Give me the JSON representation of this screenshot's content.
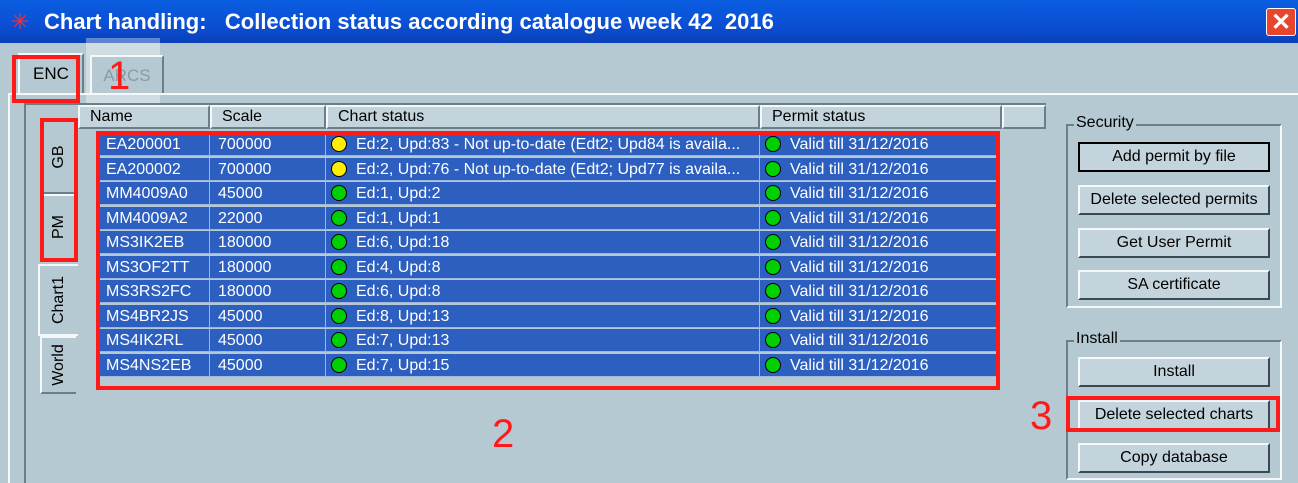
{
  "window": {
    "title": "Chart handling:   Collection status according catalogue week 42  2016",
    "close_glyph": "✕",
    "app_icon": "asterisk-icon"
  },
  "tabs": [
    "ENC",
    "ARCS"
  ],
  "side_tabs": [
    "GB",
    "PM",
    "Chart1",
    "World"
  ],
  "table": {
    "columns": [
      "Name",
      "Scale",
      "Chart status",
      "Permit status"
    ],
    "rows": [
      {
        "name": "EA200001",
        "scale": "700000",
        "status_color": "#ffee00",
        "chart_status": "Ed:2, Upd:83 - Not up-to-date (Edt2; Upd84 is availa...",
        "permit_color": "#00d000",
        "permit_status": "Valid till 31/12/2016"
      },
      {
        "name": "EA200002",
        "scale": "700000",
        "status_color": "#ffee00",
        "chart_status": "Ed:2, Upd:76 - Not up-to-date (Edt2; Upd77 is availa...",
        "permit_color": "#00d000",
        "permit_status": "Valid till 31/12/2016"
      },
      {
        "name": "MM4009A0",
        "scale": "45000",
        "status_color": "#00d000",
        "chart_status": "Ed:1, Upd:2",
        "permit_color": "#00d000",
        "permit_status": "Valid till 31/12/2016"
      },
      {
        "name": "MM4009A2",
        "scale": "22000",
        "status_color": "#00d000",
        "chart_status": "Ed:1, Upd:1",
        "permit_color": "#00d000",
        "permit_status": "Valid till 31/12/2016"
      },
      {
        "name": "MS3IK2EB",
        "scale": "180000",
        "status_color": "#00d000",
        "chart_status": "Ed:6, Upd:18",
        "permit_color": "#00d000",
        "permit_status": "Valid till 31/12/2016"
      },
      {
        "name": "MS3OF2TT",
        "scale": "180000",
        "status_color": "#00d000",
        "chart_status": "Ed:4, Upd:8",
        "permit_color": "#00d000",
        "permit_status": "Valid till 31/12/2016"
      },
      {
        "name": "MS3RS2FC",
        "scale": "180000",
        "status_color": "#00d000",
        "chart_status": "Ed:6, Upd:8",
        "permit_color": "#00d000",
        "permit_status": "Valid till 31/12/2016"
      },
      {
        "name": "MS4BR2JS",
        "scale": "45000",
        "status_color": "#00d000",
        "chart_status": "Ed:8, Upd:13",
        "permit_color": "#00d000",
        "permit_status": "Valid till 31/12/2016"
      },
      {
        "name": "MS4IK2RL",
        "scale": "45000",
        "status_color": "#00d000",
        "chart_status": "Ed:7, Upd:13",
        "permit_color": "#00d000",
        "permit_status": "Valid till 31/12/2016"
      },
      {
        "name": "MS4NS2EB",
        "scale": "45000",
        "status_color": "#00d000",
        "chart_status": "Ed:7, Upd:15",
        "permit_color": "#00d000",
        "permit_status": "Valid till 31/12/2016"
      }
    ]
  },
  "security": {
    "label": "Security",
    "buttons": [
      "Add permit by file",
      "Delete selected permits",
      "Get User Permit",
      "SA certificate"
    ]
  },
  "install": {
    "label": "Install",
    "buttons": [
      "Install",
      "Delete selected charts",
      "Copy database"
    ]
  },
  "annotations": [
    "1",
    "2",
    "3"
  ],
  "colors": {
    "annotation": "#ff1a1a",
    "selection": "#2c5fbf",
    "title_bar": "#0b4fd4"
  }
}
